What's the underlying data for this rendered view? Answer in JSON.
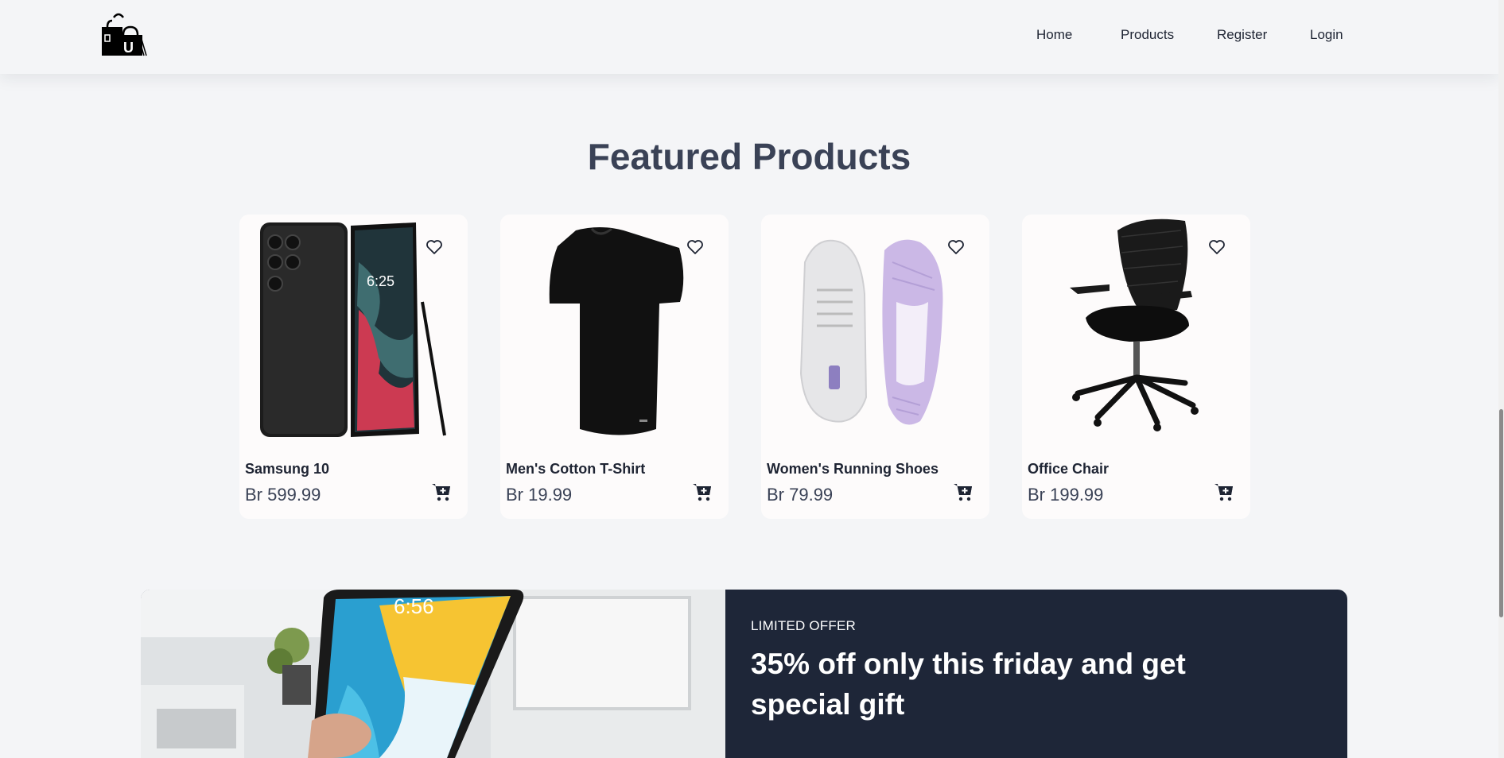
{
  "nav": {
    "logo_letter": "U",
    "links": [
      "Home",
      "Products",
      "Register",
      "Login"
    ]
  },
  "featured": {
    "title": "Featured Products",
    "products": [
      {
        "name": "Samsung 10",
        "price": "Br 599.99",
        "image": "smartphone-image"
      },
      {
        "name": "Men's Cotton T-Shirt",
        "price": "Br 19.99",
        "image": "tshirt-image"
      },
      {
        "name": "Women's Running Shoes",
        "price": "Br 79.99",
        "image": "shoes-image"
      },
      {
        "name": "Office Chair",
        "price": "Br 199.99",
        "image": "chair-image"
      }
    ]
  },
  "banner": {
    "tag": "LIMITED OFFER",
    "title": "35% off only this friday and get special gift",
    "tablet_time": "6:56"
  },
  "colors": {
    "background": "#f4f5f7",
    "card": "#fdfbfb",
    "banner": "#1e2638",
    "title": "#3a4256",
    "text": "#1e2433"
  },
  "icons": {
    "wishlist": "heart-icon",
    "cart": "add-to-cart-icon",
    "logo": "shopping-bags-logo"
  }
}
